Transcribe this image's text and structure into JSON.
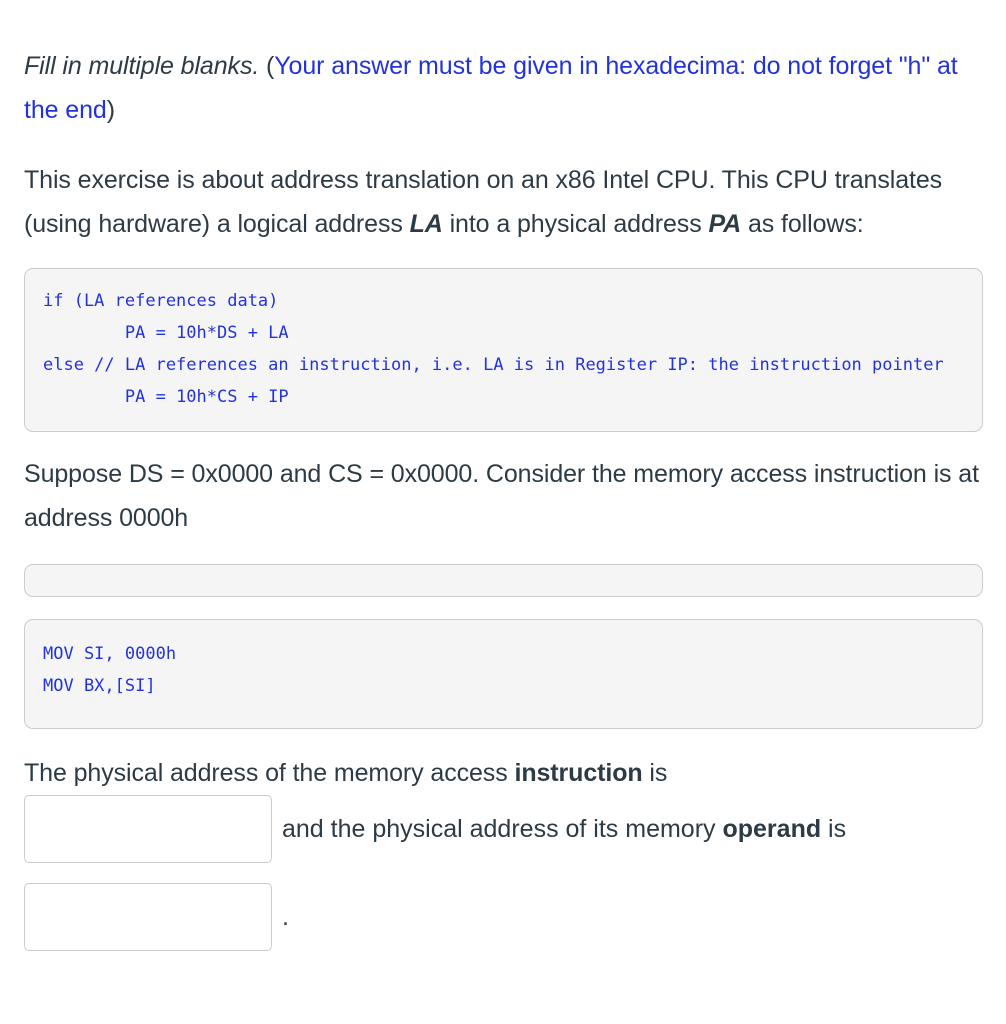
{
  "prompt": {
    "directive": "Fill in multiple blanks.",
    "note_open": " (",
    "note": "Your answer must be given in hexadecima: do not forget \"h\" at the end",
    "note_close": ")"
  },
  "intro": {
    "part1": "This exercise is about address translation on an x86 Intel CPU. This CPU translates (using hardware) a logical address ",
    "la": "LA",
    "part2": " into a physical address ",
    "pa": "PA",
    "part3": " as follows:"
  },
  "code_translation": "if (LA references data)\n        PA = 10h*DS + LA\nelse // LA references an instruction, i.e. LA is in Register IP: the instruction pointer\n        PA = 10h*CS + IP",
  "suppose": "Suppose DS = 0x0000 and CS = 0x0000. Consider the memory access instruction is at address 0000h",
  "code_empty": "",
  "code_asm": "MOV SI, 0000h\nMOV BX,[SI]",
  "answer": {
    "lead_part1": "The physical address of the memory access ",
    "lead_bold": "instruction",
    "lead_part2": " is",
    "blank1_value": "",
    "blank1_placeholder": "",
    "middle_part1": "and the physical address of its memory ",
    "middle_bold": "operand",
    "middle_part2": " is",
    "blank2_value": "",
    "blank2_placeholder": "",
    "trailing_period": "."
  },
  "colors": {
    "text": "#2d3b45",
    "accent_blue": "#2233dd",
    "code_bg": "#f5f5f5",
    "border": "#c7cdd1"
  }
}
